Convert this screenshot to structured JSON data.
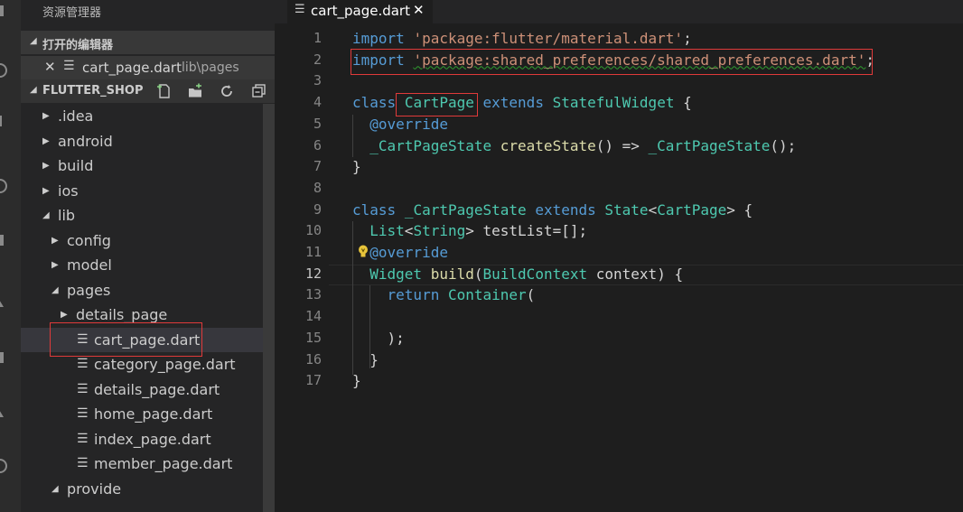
{
  "sidebar": {
    "title": "资源管理器",
    "open_editors_label": "打开的编辑器",
    "open_editor": {
      "name": "cart_page.dart",
      "path": "lib\\pages"
    },
    "project_label": "FLUTTER_SHOP",
    "toolbar_icons": [
      "new-file-icon",
      "new-folder-icon",
      "refresh-icon",
      "collapse-all-icon"
    ],
    "tree": [
      {
        "label": ".idea",
        "kind": "folder-closed"
      },
      {
        "label": "android",
        "kind": "folder-closed"
      },
      {
        "label": "build",
        "kind": "folder-closed"
      },
      {
        "label": "ios",
        "kind": "folder-closed"
      },
      {
        "label": "lib",
        "kind": "folder-open"
      },
      {
        "label": "config",
        "kind": "folder-closed"
      },
      {
        "label": "model",
        "kind": "folder-closed"
      },
      {
        "label": "pages",
        "kind": "folder-open"
      },
      {
        "label": "details_page",
        "kind": "folder-closed"
      },
      {
        "label": "cart_page.dart",
        "kind": "file",
        "selected": true
      },
      {
        "label": "category_page.dart",
        "kind": "file"
      },
      {
        "label": "details_page.dart",
        "kind": "file"
      },
      {
        "label": "home_page.dart",
        "kind": "file"
      },
      {
        "label": "index_page.dart",
        "kind": "file"
      },
      {
        "label": "member_page.dart",
        "kind": "file"
      },
      {
        "label": "provide",
        "kind": "folder-open"
      }
    ]
  },
  "editor": {
    "tab": {
      "name": "cart_page.dart",
      "close": "✕"
    },
    "current_line": 12,
    "line_numbers": [
      "1",
      "2",
      "3",
      "4",
      "5",
      "6",
      "7",
      "8",
      "9",
      "10",
      "11",
      "12",
      "13",
      "14",
      "15",
      "16",
      "17"
    ],
    "lines": [
      [
        [
          "kw",
          "import"
        ],
        [
          "punc",
          " "
        ],
        [
          "str",
          "'package:flutter/material.dart'"
        ],
        [
          "punc",
          ";"
        ]
      ],
      [
        [
          "kw",
          "import"
        ],
        [
          "punc",
          " "
        ],
        [
          "str",
          "'package:shared_preferences/shared_preferences.dart'"
        ],
        [
          "punc",
          ";"
        ]
      ],
      [],
      [
        [
          "kw",
          "class"
        ],
        [
          "punc",
          " "
        ],
        [
          "typ",
          "CartPage"
        ],
        [
          "punc",
          " "
        ],
        [
          "kw",
          "extends"
        ],
        [
          "punc",
          " "
        ],
        [
          "typ",
          "StatefulWidget"
        ],
        [
          "punc",
          " {"
        ]
      ],
      [
        [
          "punc",
          "  "
        ],
        [
          "dec",
          "@override"
        ]
      ],
      [
        [
          "punc",
          "  "
        ],
        [
          "typ",
          "_CartPageState"
        ],
        [
          "punc",
          " "
        ],
        [
          "fn",
          "createState"
        ],
        [
          "punc",
          "() => "
        ],
        [
          "typ",
          "_CartPageState"
        ],
        [
          "punc",
          "();"
        ]
      ],
      [
        [
          "punc",
          "}"
        ]
      ],
      [],
      [
        [
          "kw",
          "class"
        ],
        [
          "punc",
          " "
        ],
        [
          "typ",
          "_CartPageState"
        ],
        [
          "punc",
          " "
        ],
        [
          "kw",
          "extends"
        ],
        [
          "punc",
          " "
        ],
        [
          "typ",
          "State"
        ],
        [
          "punc",
          "<"
        ],
        [
          "typ",
          "CartPage"
        ],
        [
          "punc",
          "> {"
        ]
      ],
      [
        [
          "punc",
          "  "
        ],
        [
          "typ",
          "List"
        ],
        [
          "punc",
          "<"
        ],
        [
          "typ",
          "String"
        ],
        [
          "punc",
          "> "
        ],
        [
          "var",
          "testList"
        ],
        [
          "punc",
          "=[];"
        ]
      ],
      [
        [
          "punc",
          "  "
        ],
        [
          "dec",
          "@override"
        ]
      ],
      [
        [
          "punc",
          "  "
        ],
        [
          "typ",
          "Widget"
        ],
        [
          "punc",
          " "
        ],
        [
          "fn",
          "build"
        ],
        [
          "punc",
          "("
        ],
        [
          "typ",
          "BuildContext"
        ],
        [
          "punc",
          " "
        ],
        [
          "var",
          "context"
        ],
        [
          "punc",
          ") {"
        ]
      ],
      [
        [
          "punc",
          "    "
        ],
        [
          "kw",
          "return"
        ],
        [
          "punc",
          " "
        ],
        [
          "typ",
          "Container"
        ],
        [
          "punc",
          "("
        ]
      ],
      [],
      [
        [
          "punc",
          "    );"
        ]
      ],
      [
        [
          "punc",
          "  }"
        ]
      ],
      [
        [
          "punc",
          "}"
        ]
      ]
    ]
  }
}
